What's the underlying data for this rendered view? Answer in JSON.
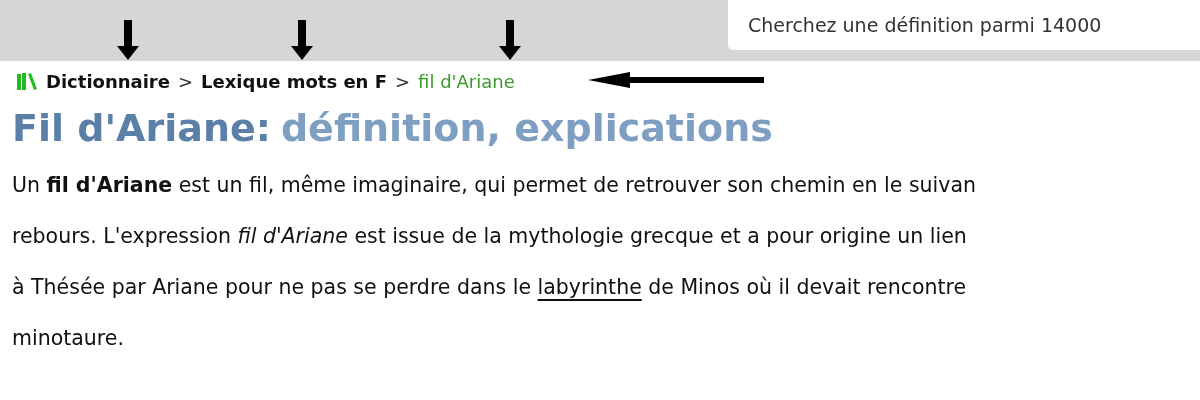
{
  "search": {
    "placeholder": "Cherchez une définition parmi 14000"
  },
  "breadcrumb": [
    {
      "label": "Dictionnaire",
      "current": false
    },
    {
      "label": ">",
      "kind": "separator"
    },
    {
      "label": "Lexique mots en F",
      "current": false
    },
    {
      "label": ">",
      "kind": "separator"
    },
    {
      "label": "fil d'Ariane",
      "current": true
    }
  ],
  "title": {
    "term": "Fil d'Ariane",
    "separator": ":",
    "subtitle": "définition, explications"
  },
  "paragraph": [
    [
      {
        "kind": "text",
        "text": "Un **fil d'Ariane** est un fil, même imaginaire, qui permet de retrouver son chemin en le suivan"
      }
    ],
    [
      {
        "kind": "text",
        "text": "rebours. L'expression *fil d'Ariane* est issue de la mythologie grecque et a pour origine un lien"
      }
    ],
    [
      {
        "kind": "text",
        "text": "à Thésée par Ariane pour ne pas se perdre dans le "
      },
      {
        "kind": "link",
        "text": "labyrinthe"
      },
      {
        "kind": "text",
        "text": " de Minos où il devait rencontre"
      }
    ],
    [
      {
        "kind": "text",
        "text": "minotaure."
      }
    ]
  ]
}
